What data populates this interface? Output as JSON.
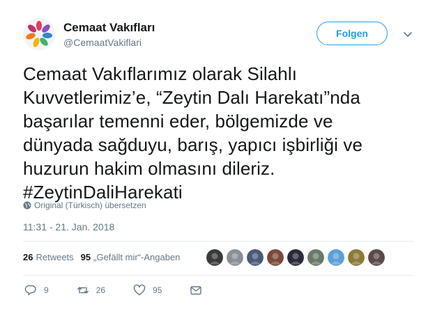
{
  "author": {
    "name": "Cemaat Vakıfları",
    "handle": "@CemaatVakiflari"
  },
  "follow_button": {
    "label": "Folgen"
  },
  "tweet": {
    "lines": [
      "Cemaat Vakıflarımız olarak Silahlı",
      "Kuvvetlerimiz’e, “Zeytin Dalı Harekatı”nda",
      "başarılar temenni eder, bölgemizde ve",
      "dünyada sağduyu, barış, yapıcı işbirliği ve",
      "huzurun hakim olmasını dileriz."
    ],
    "hashtag": "#ZeytinDaliHarekati"
  },
  "translate_note": "Original (Türkisch) übersetzen",
  "timestamp": "11:31 - 21. Jan. 2018",
  "stats": {
    "retweets_count": "26",
    "retweets_label": "Retweets",
    "likes_count": "95",
    "likes_label": "„Gefällt mir“-Angaben"
  },
  "likers": [
    {
      "color": "#3a3a3a"
    },
    {
      "color": "#8a8f96"
    },
    {
      "color": "#4a5a78"
    },
    {
      "color": "#7a4a3a"
    },
    {
      "color": "#2a2a3a"
    },
    {
      "color": "#6a7a6a"
    },
    {
      "color": "#5aa0d8"
    },
    {
      "color": "#8a7a3a"
    },
    {
      "color": "#5a4a4a"
    }
  ],
  "actions": {
    "reply_count": "9",
    "retweet_count": "26",
    "like_count": "95"
  },
  "colors": {
    "accent": "#1da1f2",
    "text": "#14171a",
    "muted": "#657786",
    "divider": "#e6ecf0"
  }
}
